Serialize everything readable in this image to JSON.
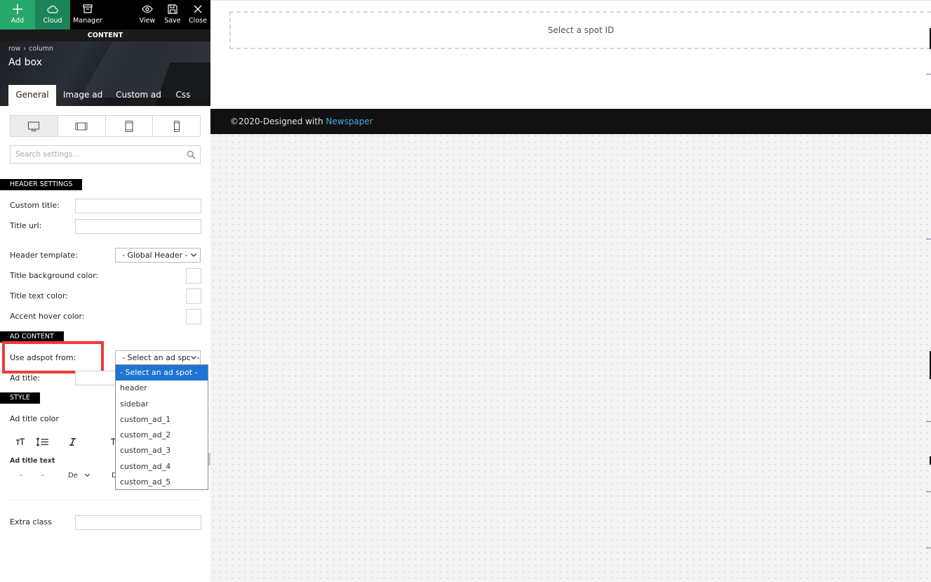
{
  "toolbar": {
    "add_label": "Add",
    "cloud_label": "Cloud",
    "manager_label": "Manager",
    "view_label": "View",
    "save_label": "Save",
    "close_label": "Close"
  },
  "content_bar": "CONTENT",
  "breadcrumb": {
    "row": "row",
    "sep": "›",
    "column": "column"
  },
  "element_title": "Ad box",
  "tabs": [
    "General",
    "Image ad",
    "Custom ad",
    "Css"
  ],
  "search": {
    "placeholder": "Search settings..."
  },
  "header_settings": {
    "section": "HEADER SETTINGS",
    "custom_title": "Custom title:",
    "title_url": "Title url:",
    "header_template": "Header template:",
    "header_template_value": "- Global Header -",
    "title_bg_color": "Title background color:",
    "title_text_color": "Title text color:",
    "accent_hover_color": "Accent hover color:"
  },
  "ad_content": {
    "section": "AD CONTENT",
    "use_adspot": "Use adspot from:",
    "adspot_value": "- Select an ad spot -",
    "ad_title": "Ad title:",
    "options": [
      "- Select an ad spot -",
      "header",
      "sidebar",
      "custom_ad_1",
      "custom_ad_2",
      "custom_ad_3",
      "custom_ad_4",
      "custom_ad_5"
    ]
  },
  "style": {
    "section": "STYLE",
    "ad_title_color": "Ad title color",
    "ad_title_text": "Ad title text",
    "dash1": "-",
    "dash2": "-",
    "default_short": "De",
    "default_short2": "D",
    "extra_class": "Extra class"
  },
  "preview": {
    "spot_placeholder": "Select a spot ID",
    "footer_text": "©2020-Designed with ",
    "footer_link": "Newspaper"
  },
  "colors": {
    "add_green": "#27a86b",
    "cloud_green": "#1d8459",
    "highlight_red": "#ef3a3a",
    "selected_blue": "#1e74d2",
    "footer_link": "#48a9e6"
  }
}
